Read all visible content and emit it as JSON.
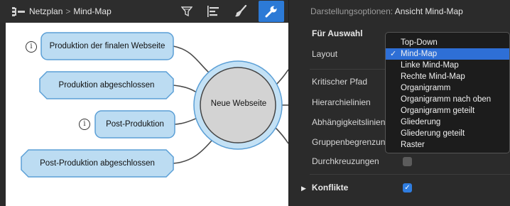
{
  "toolbar": {
    "breadcrumb": [
      "Netzplan",
      "Mind-Map"
    ],
    "separator": ">",
    "icons": [
      "network-plan-icon",
      "filter-icon",
      "align-left-icon",
      "brush-icon",
      "wrench-icon"
    ]
  },
  "canvas": {
    "center": "Neue Webseite",
    "info_glyph": "i",
    "nodes": [
      "Produktion der finalen Webseite",
      "Produktion abgeschlossen",
      "Post-Produktion",
      "Post-Produktion abgeschlossen"
    ]
  },
  "panel": {
    "title_prefix": "Darstellungsoptionen:",
    "title_value": "Ansicht Mind-Map",
    "section": "Für Auswahl",
    "rows": [
      "Layout",
      "Kritischer Pfad",
      "Hierarchielinien",
      "Abhängigkeitslinien",
      "Gruppenbegrenzung",
      "Durchkreuzungen"
    ],
    "konflikte": "Konflikte",
    "check_glyph": "✓",
    "colors": {
      "accent": "#2e6fd6",
      "node_fill": "#bcdcf2",
      "node_stroke": "#5b9fd6"
    }
  },
  "dropdown": {
    "selected_index": 1,
    "options": [
      "Top-Down",
      "Mind-Map",
      "Linke Mind-Map",
      "Rechte Mind-Map",
      "Organigramm",
      "Organigramm nach oben",
      "Organigramm geteilt",
      "Gliederung",
      "Gliederung geteilt",
      "Raster"
    ]
  }
}
